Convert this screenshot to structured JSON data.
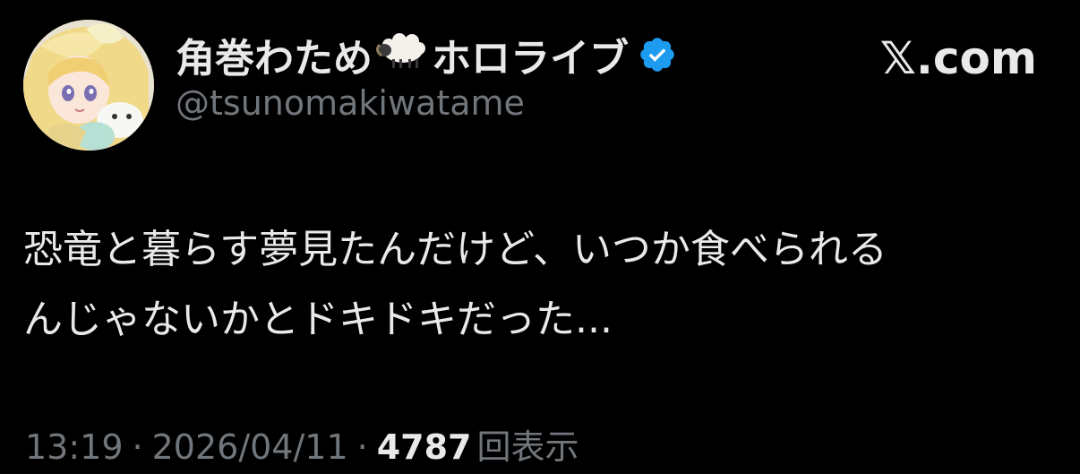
{
  "author": {
    "display_name": "角巻わため",
    "affiliation": "ホロライブ",
    "handle": "@tsunomakiwatame",
    "emoji_icon": "sheep-emoji",
    "verified_icon": "verified-badge-icon",
    "verified_color": "#1d9bf0"
  },
  "brand": {
    "label": "𝕏.com"
  },
  "tweet": {
    "line1": "恐竜と暮らす夢見たんだけど、いつか食べられる",
    "line2": "んじゃないかとドキドキだった..."
  },
  "meta": {
    "time": "13:19",
    "separator": "·",
    "date": "2026/04/11",
    "views_count": "4787",
    "views_label": "回表示"
  },
  "colors": {
    "background": "#000000",
    "primary_text": "#e7e9ea",
    "secondary_text": "#71767b"
  }
}
